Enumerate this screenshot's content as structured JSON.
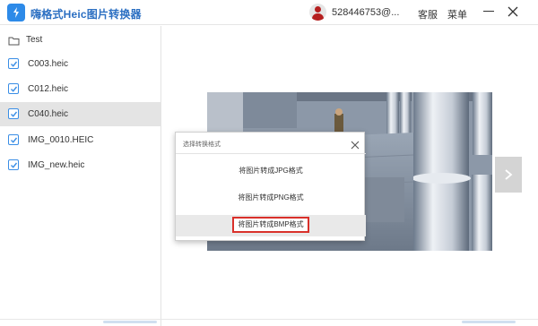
{
  "app": {
    "title": "嗨格式Heic图片转换器",
    "accent": "#2d8ae8"
  },
  "header": {
    "username": "528446753@...",
    "support_label": "客服",
    "menu_label": "菜单"
  },
  "sidebar": {
    "folder": "Test",
    "files": [
      {
        "name": "C003.heic",
        "checked": true,
        "active": false
      },
      {
        "name": "C012.heic",
        "checked": true,
        "active": false
      },
      {
        "name": "C040.heic",
        "checked": true,
        "active": true
      },
      {
        "name": "IMG_0010.HEIC",
        "checked": true,
        "active": false
      },
      {
        "name": "IMG_new.heic",
        "checked": true,
        "active": false
      }
    ]
  },
  "dialog": {
    "title": "选择转换格式",
    "options": [
      {
        "label": "将图片转成JPG格式"
      },
      {
        "label": "将图片转成PNG格式"
      },
      {
        "label": "将图片转成BMP格式",
        "highlighted": true
      }
    ],
    "highlight_color": "#d9302a"
  },
  "icons": [
    "app-logo-icon",
    "folder-icon",
    "checkbox-icon",
    "minimize-icon",
    "close-icon",
    "chevron-right-icon"
  ]
}
